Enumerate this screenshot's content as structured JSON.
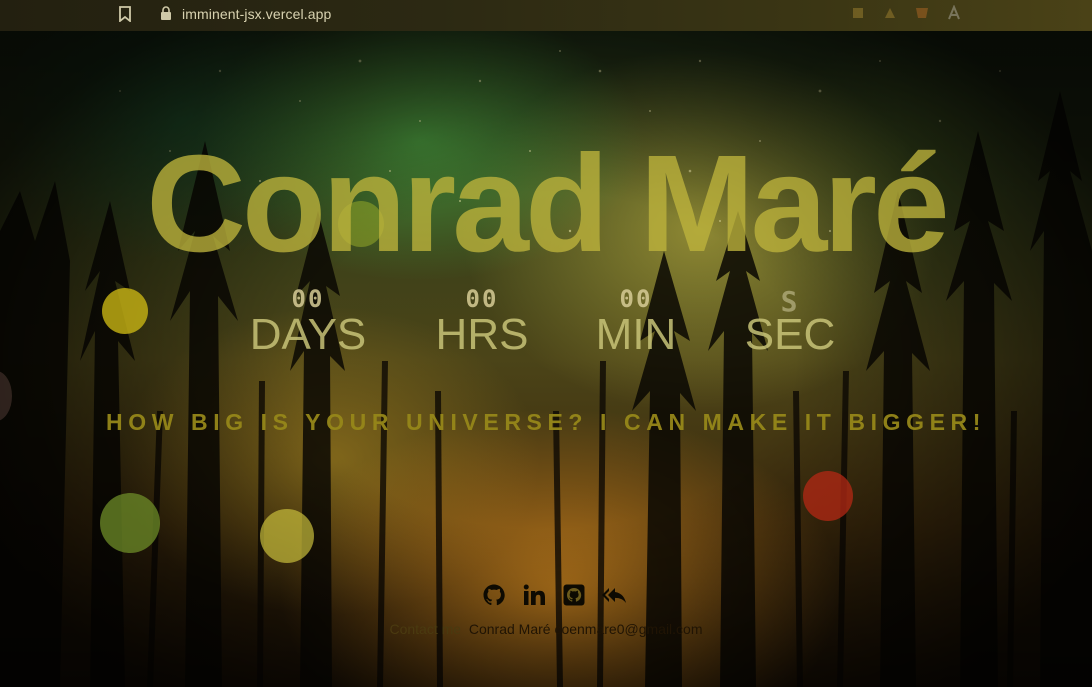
{
  "browser": {
    "url": "imminent-jsx.vercel.app"
  },
  "hero": {
    "title": "Conrad Maré",
    "countdown": [
      {
        "value": "00",
        "label": "DAYS"
      },
      {
        "value": "00",
        "label": "HRS"
      },
      {
        "value": "00",
        "label": "MIN"
      },
      {
        "value": "S",
        "label": "SEC"
      }
    ],
    "tagline": "HOW BIG IS YOUR UNIVERSE? I CAN MAKE IT BIGGER!"
  },
  "footer": {
    "socials": [
      {
        "icon": "github-icon"
      },
      {
        "icon": "linkedin-icon"
      },
      {
        "icon": "github-square-icon"
      },
      {
        "icon": "reply-all-icon"
      }
    ],
    "contact_label": "Contact me",
    "contact_name": "Conrad Maré",
    "contact_email": "coenmare0@gmail.com"
  },
  "colors": {
    "title": "#BEB43C",
    "tagline": "#968719",
    "icons": "#0d0a02"
  }
}
